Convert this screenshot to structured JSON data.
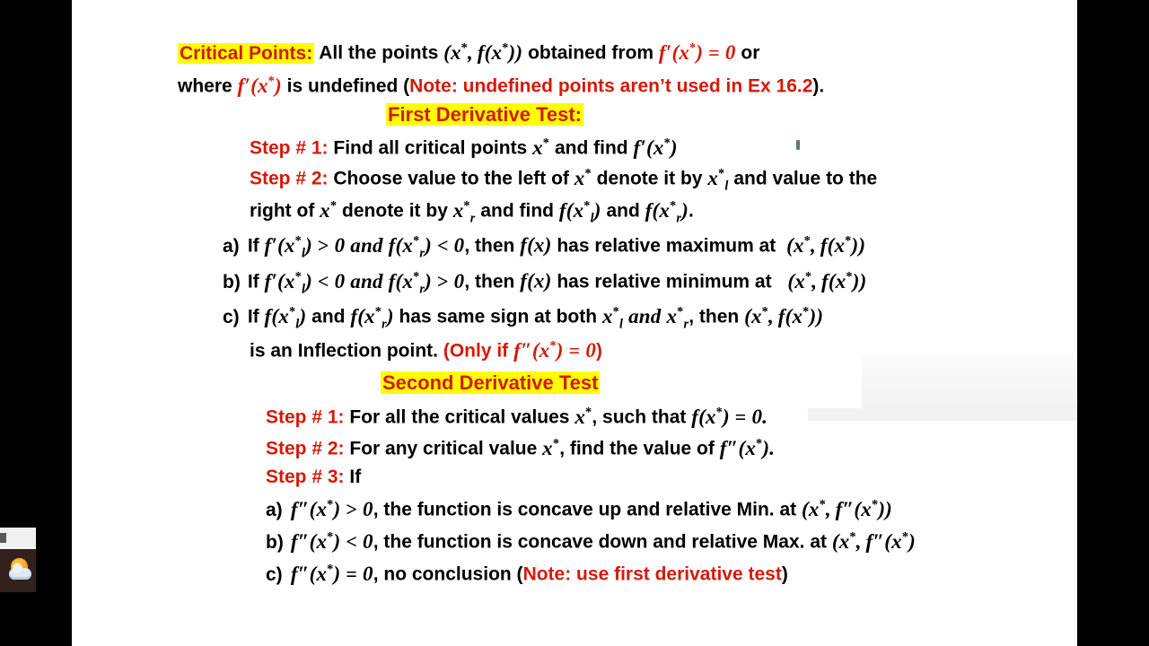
{
  "slide": {
    "background_color": "#ffffff",
    "letterbox_color": "#000000",
    "highlight_color": "#ffff00",
    "accent_color": "#d41a08",
    "text_color": "#000000",
    "title_term": "Critical Points:",
    "line1_rest_a": "All the points",
    "line1_math_point": "(x*, f(x*))",
    "line1_rest_b": "obtained from",
    "line1_math_eq": "f′(x*) = 0",
    "line1_rest_c": "or",
    "line2_a": "where",
    "line2_math": "f′(x*)",
    "line2_b": "is undefined (",
    "line2_note": "Note: undefined points aren’t used in Ex 16.2",
    "line2_c": ").",
    "first_test_heading": "First Derivative Test:",
    "first_step1_label": "Step # 1:",
    "first_step1_text_a": "Find all critical points",
    "first_step1_math_a": "x*",
    "first_step1_text_b": "and find",
    "first_step1_math_b": "f′(x*)",
    "first_step2_label": "Step # 2:",
    "first_step2_text_a": "Choose value to the left of",
    "first_step2_math_a": "x*",
    "first_step2_text_b": "denote it by",
    "first_step2_math_b": "x*ₗ",
    "first_step2_text_c": "and value to the",
    "first_step2_line2_a": "right of",
    "first_step2_line2_math_a": "x*",
    "first_step2_line2_b": "denote it by",
    "first_step2_line2_math_b": "x*ᵣ",
    "first_step2_line2_c": "and find",
    "first_step2_line2_math_c": "f(x*ₗ)",
    "first_step2_line2_d": "and",
    "first_step2_line2_math_d": "f(x*ᵣ)",
    "first_step2_line2_e": ".",
    "item_a_label": "a)",
    "item_a_if": "If",
    "item_a_math1": "f′(x*ₗ) > 0 and f(x*ᵣ) < 0",
    "item_a_text1": ", then",
    "item_a_math2": "f(x)",
    "item_a_text2": "has relative maximum at",
    "item_a_math3": "(x*, f(x*))",
    "item_b_label": "b)",
    "item_b_if": "If",
    "item_b_math1": "f′(x*ₗ) < 0 and f(x*ᵣ) > 0",
    "item_b_text1": ", then",
    "item_b_math2": "f(x)",
    "item_b_text2": "has relative minimum at",
    "item_b_math3": "(x*, f(x*))",
    "item_c_label": "c)",
    "item_c_if": "If",
    "item_c_math1": "f(x*ₗ)",
    "item_c_text1": "and",
    "item_c_math2": "f(x*ᵣ)",
    "item_c_text2": "has same sign at both",
    "item_c_math3": "x*ₗ and x*ᵣ",
    "item_c_text3": ", then",
    "item_c_math4": "(x*, f(x*))",
    "item_c_line2_a": "is an Inflection point.",
    "item_c_line2_note_open": "(Only if",
    "item_c_line2_note_math": "f″(x*) = 0",
    "item_c_line2_note_close": ")",
    "second_test_heading": "Second Derivative Test",
    "second_step1_label": "Step # 1:",
    "second_step1_text_a": "For all the critical values",
    "second_step1_math_a": "x*",
    "second_step1_text_b": ", such that",
    "second_step1_math_b": "f(x*) = 0.",
    "second_step2_label": "Step # 2:",
    "second_step2_text_a": "For any critical value",
    "second_step2_math_a": "x*",
    "second_step2_text_b": ", find the value of",
    "second_step2_math_b": "f″(x*).",
    "second_step3_label": "Step # 3:",
    "second_step3_text": "If",
    "s_item_a_label": "a)",
    "s_item_a_math1": "f″(x*) > 0",
    "s_item_a_text": ", the function is concave up and relative Min. at",
    "s_item_a_math2": "(x*, f″(x*))",
    "s_item_b_label": "b)",
    "s_item_b_math1": "f″(x*) < 0",
    "s_item_b_text": ", the function is concave down and relative Max. at",
    "s_item_b_math2": "(x*, f″(x*))",
    "s_item_c_label": "c)",
    "s_item_c_math1": "f″(x*) = 0",
    "s_item_c_text": ", no conclusion (",
    "s_item_c_note": "Note: use first derivative test",
    "s_item_c_close": ")"
  },
  "taskbar": {
    "icon": "weather-sun-cloud-icon"
  }
}
